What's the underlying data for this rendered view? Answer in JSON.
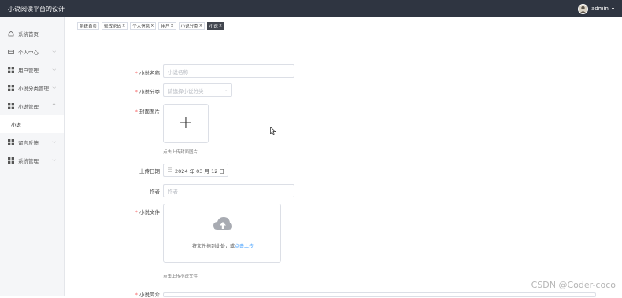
{
  "header": {
    "title": "小说阅读平台的设计",
    "user_name": "admin",
    "caret": "▾"
  },
  "sidebar": {
    "items": [
      {
        "label": "系统首页",
        "icon": "home-icon"
      },
      {
        "label": "个人中心",
        "icon": "id-card-icon"
      },
      {
        "label": "用户管理",
        "icon": "grid-icon"
      },
      {
        "label": "小说分类管理",
        "icon": "grid-icon"
      },
      {
        "label": "小说管理",
        "icon": "grid-icon"
      },
      {
        "label": "小说",
        "icon": ""
      },
      {
        "label": "留言反馈",
        "icon": "grid-icon"
      },
      {
        "label": "系统管理",
        "icon": "grid-icon"
      }
    ]
  },
  "tabs": [
    {
      "label": "系统首页",
      "closable": false
    },
    {
      "label": "修改密码",
      "closable": true
    },
    {
      "label": "个人信息",
      "closable": true
    },
    {
      "label": "用户",
      "closable": true
    },
    {
      "label": "小说分类",
      "closable": true
    },
    {
      "label": "小说",
      "closable": true,
      "active": true
    }
  ],
  "form": {
    "name": {
      "label": "小说名称",
      "placeholder": "小说名称"
    },
    "category": {
      "label": "小说分类",
      "placeholder": "请选择小说分类"
    },
    "cover": {
      "label": "封面图片",
      "hint": "点击上传封面图片"
    },
    "upload_date": {
      "label": "上传日期",
      "value": "2024 年 03 月 12 日"
    },
    "author": {
      "label": "作者",
      "placeholder": "作者"
    },
    "file": {
      "label": "小说文件",
      "drop_text": "将文件拖到此处，或",
      "drop_link": "点击上传",
      "hint": "点击上传小说文件"
    },
    "intro": {
      "label": "小说简介"
    }
  },
  "watermark": "CSDN @Coder-coco",
  "colors": {
    "topbar": "#2f3541",
    "link": "#409eff",
    "required": "#f56c6c"
  }
}
